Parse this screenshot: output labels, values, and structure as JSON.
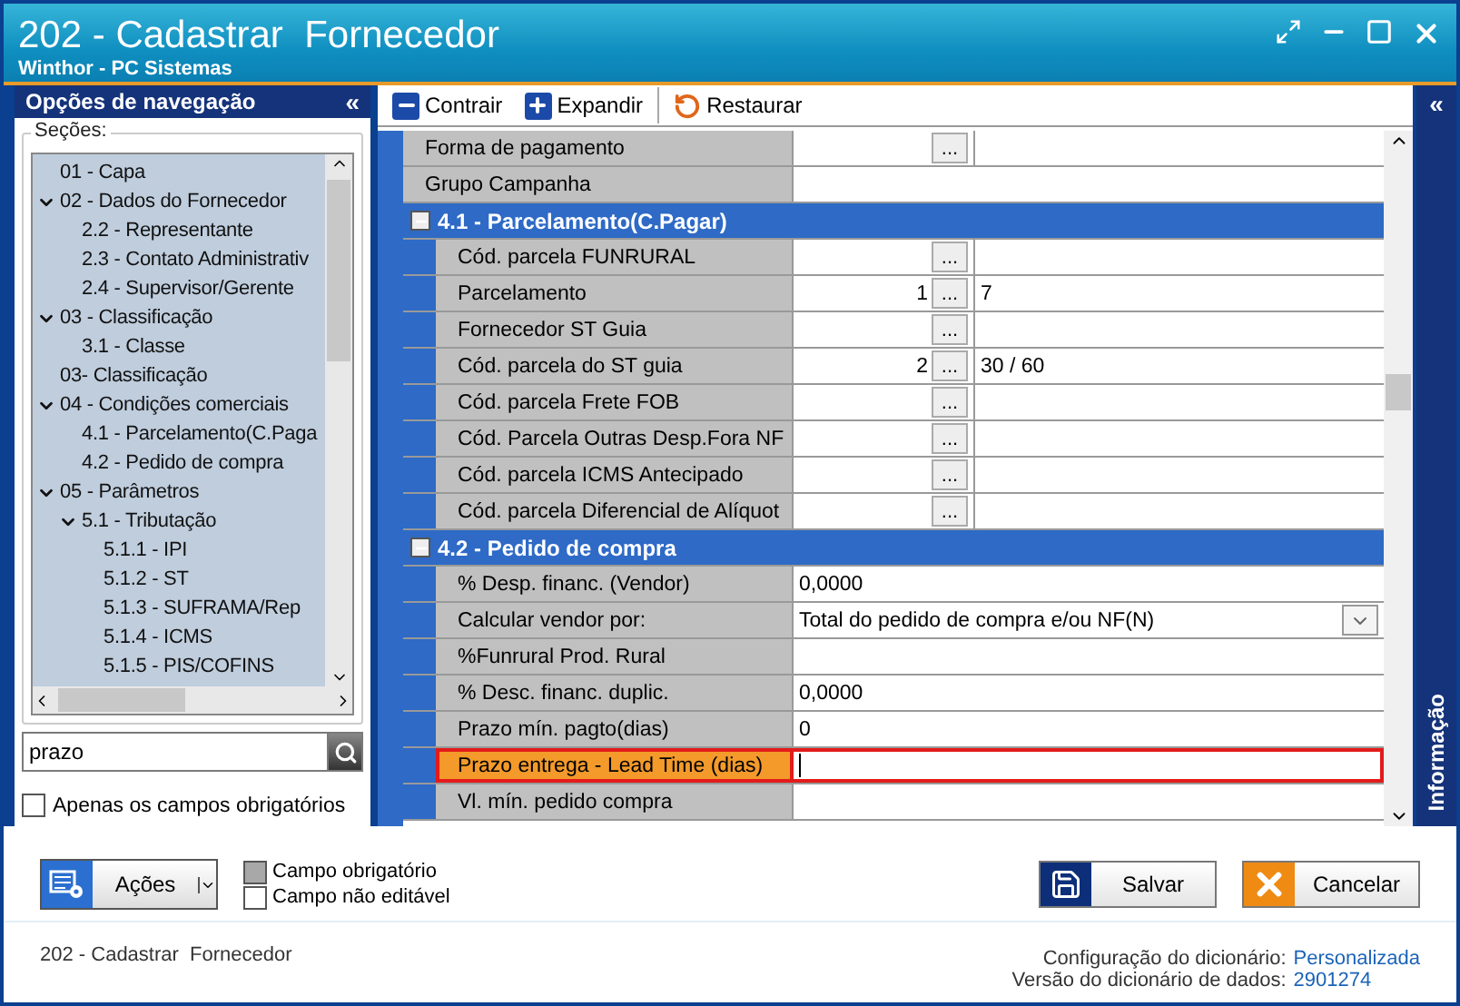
{
  "window": {
    "title": "202 - Cadastrar  Fornecedor",
    "subtitle": "Winthor - PC Sistemas"
  },
  "navigation": {
    "title": "Opções de navegação",
    "collapse": "«",
    "group_label": "Seções:",
    "tree": [
      {
        "label": "01 - Capa",
        "expanded": false
      },
      {
        "label": "02 - Dados do Fornecedor",
        "expanded": true,
        "children": [
          {
            "label": "2.2 - Representante",
            "expanded": false
          },
          {
            "label": "2.3 - Contato Administrativ",
            "expanded": false
          },
          {
            "label": "2.4 - Supervisor/Gerente",
            "expanded": false
          }
        ]
      },
      {
        "label": "03 - Classificação",
        "expanded": true,
        "children": [
          {
            "label": "3.1 - Classe",
            "expanded": false
          }
        ]
      },
      {
        "label": "03- Classificação",
        "expanded": false
      },
      {
        "label": "04 - Condições comerciais",
        "expanded": true,
        "children": [
          {
            "label": "4.1 - Parcelamento(C.Paga",
            "expanded": false
          },
          {
            "label": "4.2 - Pedido de compra",
            "expanded": false
          }
        ]
      },
      {
        "label": "05 - Parâmetros",
        "expanded": true,
        "children": [
          {
            "label": "5.1 - Tributação",
            "expanded": true,
            "children": [
              {
                "label": "5.1.1 - IPI",
                "expanded": false
              },
              {
                "label": "5.1.2 - ST",
                "expanded": false
              },
              {
                "label": "5.1.3 - SUFRAMA/Rep",
                "expanded": false
              },
              {
                "label": "5.1.4 - ICMS",
                "expanded": false
              },
              {
                "label": "5.1.5 - PIS/COFINS",
                "expanded": false
              }
            ]
          }
        ]
      }
    ],
    "search": {
      "value": "prazo"
    },
    "only_required": {
      "label": "Apenas os campos obrigatórios",
      "checked": false
    }
  },
  "toolbar": [
    {
      "kind": "collapse",
      "label": "Contrair"
    },
    {
      "kind": "expand",
      "label": "Expandir"
    },
    {
      "kind": "restore",
      "label": "Restaurar"
    }
  ],
  "grid": {
    "rows": [
      {
        "kind": "lookup",
        "label": "Forma de pagamento",
        "button": "...",
        "selected": false
      },
      {
        "kind": "text",
        "label": "Grupo Campanha",
        "selected": false
      },
      {
        "kind": "section",
        "label": "4.1 - Parcelamento(C.Pagar)",
        "expanded": true,
        "children": [
          {
            "kind": "lookup",
            "label": "Cód. parcela FUNRURAL",
            "button": "...",
            "selected": false
          },
          {
            "kind": "lookup",
            "label": "Parcelamento",
            "value": "1",
            "button": "...",
            "detail": "7",
            "selected": false
          },
          {
            "kind": "lookup",
            "label": "Fornecedor ST Guia",
            "button": "...",
            "selected": false
          },
          {
            "kind": "lookup",
            "label": "Cód. parcela do ST guia",
            "value": "2",
            "button": "...",
            "detail": "30 / 60",
            "selected": false
          },
          {
            "kind": "lookup",
            "label": "Cód. parcela Frete FOB",
            "button": "...",
            "selected": false
          },
          {
            "kind": "lookup",
            "label": "Cód. Parcela Outras Desp.Fora NF",
            "button": "...",
            "selected": false
          },
          {
            "kind": "lookup",
            "label": "Cód. parcela ICMS Antecipado",
            "button": "...",
            "selected": false
          },
          {
            "kind": "lookup",
            "label": "Cód. parcela Diferencial de Alíquot",
            "button": "...",
            "selected": false
          }
        ]
      },
      {
        "kind": "section",
        "label": "4.2 - Pedido de compra",
        "expanded": true,
        "children": [
          {
            "kind": "text",
            "label": "% Desp. financ. (Vendor)",
            "value": "0,0000",
            "selected": false
          },
          {
            "kind": "dropdown",
            "label": "Calcular vendor por:",
            "value": "Total do pedido de compra e/ou NF(N)",
            "selected": false
          },
          {
            "kind": "text",
            "label": "%Funrural Prod. Rural",
            "selected": false
          },
          {
            "kind": "text",
            "label": "% Desc. financ. duplic.",
            "value": "0,0000",
            "selected": false
          },
          {
            "kind": "text",
            "label": "Prazo mín. pagto(dias)",
            "value": "0",
            "selected": false
          },
          {
            "kind": "text",
            "label": "Prazo entrega - Lead Time (dias)",
            "selected": true
          },
          {
            "kind": "text",
            "label": "Vl. mín. pedido compra",
            "selected": false
          }
        ]
      }
    ]
  },
  "side_panel": {
    "title": "Informação",
    "collapse": "«"
  },
  "actions": {
    "label": "Ações"
  },
  "legend": [
    {
      "label": "Campo obrigatório",
      "color": "#a8a8a8"
    },
    {
      "label": "Campo não editável",
      "color": "#ffffff"
    }
  ],
  "buttons": [
    {
      "kind": "save",
      "label": "Salvar"
    },
    {
      "kind": "cancel",
      "label": "Cancelar"
    }
  ],
  "status_bar": {
    "screen": "202 - Cadastrar  Fornecedor",
    "dictionary_label": "Configuração do dicionário:",
    "dictionary_value": "Personalizada",
    "version_label": "Versão do dicionário de dados:",
    "version_value": "2901274"
  }
}
